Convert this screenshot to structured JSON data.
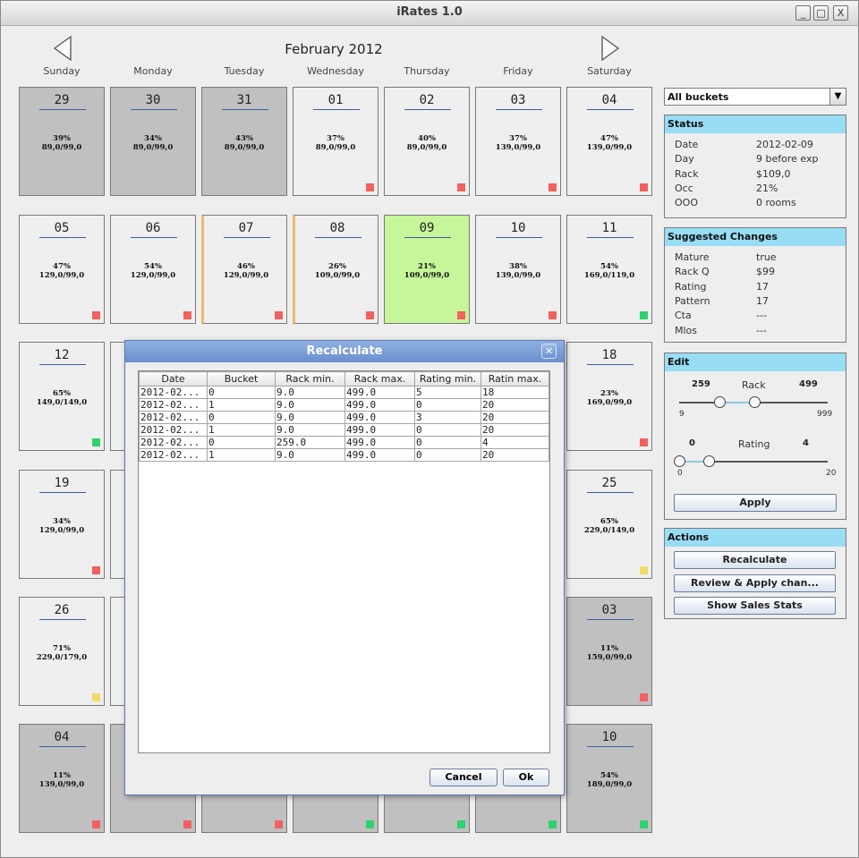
{
  "window": {
    "title": "iRates 1.0",
    "controls": [
      "_",
      "□",
      "X"
    ]
  },
  "calendar": {
    "month_title": "February 2012",
    "day_names": [
      "Sunday",
      "Monday",
      "Tuesday",
      "Wednesday",
      "Thursday",
      "Friday",
      "Saturday"
    ],
    "rows": [
      [
        {
          "day": "29",
          "occ": "39%",
          "rate": "89,0/99,0",
          "style": "gray",
          "flag": ""
        },
        {
          "day": "30",
          "occ": "34%",
          "rate": "89,0/99,0",
          "style": "gray",
          "flag": ""
        },
        {
          "day": "31",
          "occ": "43%",
          "rate": "89,0/99,0",
          "style": "gray",
          "flag": ""
        },
        {
          "day": "01",
          "occ": "37%",
          "rate": "89,0/99,0",
          "style": "",
          "flag": "red"
        },
        {
          "day": "02",
          "occ": "40%",
          "rate": "89,0/99,0",
          "style": "",
          "flag": "red"
        },
        {
          "day": "03",
          "occ": "37%",
          "rate": "139,0/99,0",
          "style": "",
          "flag": "red"
        },
        {
          "day": "04",
          "occ": "47%",
          "rate": "139,0/99,0",
          "style": "",
          "flag": "red"
        }
      ],
      [
        {
          "day": "05",
          "occ": "47%",
          "rate": "129,0/99,0",
          "style": "",
          "flag": "red"
        },
        {
          "day": "06",
          "occ": "54%",
          "rate": "129,0/99,0",
          "style": "",
          "flag": "red"
        },
        {
          "day": "07",
          "occ": "46%",
          "rate": "129,0/99,0",
          "style": "orange",
          "flag": "red"
        },
        {
          "day": "08",
          "occ": "26%",
          "rate": "109,0/99,0",
          "style": "orange",
          "flag": "red"
        },
        {
          "day": "09",
          "occ": "21%",
          "rate": "109,0/99,0",
          "style": "green",
          "flag": "red"
        },
        {
          "day": "10",
          "occ": "38%",
          "rate": "139,0/99,0",
          "style": "",
          "flag": "red"
        },
        {
          "day": "11",
          "occ": "54%",
          "rate": "169,0/119,0",
          "style": "",
          "flag": "green"
        }
      ],
      [
        {
          "day": "12",
          "occ": "65%",
          "rate": "149,0/149,0",
          "style": "",
          "flag": "green"
        },
        {
          "day": "",
          "occ": "",
          "rate": "",
          "style": "",
          "flag": ""
        },
        {
          "day": "",
          "occ": "",
          "rate": "",
          "style": "",
          "flag": ""
        },
        {
          "day": "",
          "occ": "",
          "rate": "",
          "style": "",
          "flag": ""
        },
        {
          "day": "",
          "occ": "",
          "rate": "",
          "style": "",
          "flag": ""
        },
        {
          "day": "",
          "occ": "",
          "rate": "",
          "style": "",
          "flag": ""
        },
        {
          "day": "18",
          "occ": "23%",
          "rate": "169,0/99,0",
          "style": "",
          "flag": "red"
        }
      ],
      [
        {
          "day": "19",
          "occ": "34%",
          "rate": "129,0/99,0",
          "style": "",
          "flag": "red"
        },
        {
          "day": "",
          "occ": "",
          "rate": "",
          "style": "",
          "flag": ""
        },
        {
          "day": "",
          "occ": "",
          "rate": "",
          "style": "",
          "flag": ""
        },
        {
          "day": "",
          "occ": "",
          "rate": "",
          "style": "",
          "flag": ""
        },
        {
          "day": "",
          "occ": "",
          "rate": "",
          "style": "",
          "flag": ""
        },
        {
          "day": "",
          "occ": "",
          "rate": "",
          "style": "",
          "flag": ""
        },
        {
          "day": "25",
          "occ": "65%",
          "rate": "229,0/149,0",
          "style": "",
          "flag": "yellow"
        }
      ],
      [
        {
          "day": "26",
          "occ": "71%",
          "rate": "229,0/179,0",
          "style": "",
          "flag": "yellow"
        },
        {
          "day": "",
          "occ": "",
          "rate": "",
          "style": "",
          "flag": ""
        },
        {
          "day": "",
          "occ": "",
          "rate": "",
          "style": "",
          "flag": ""
        },
        {
          "day": "",
          "occ": "",
          "rate": "",
          "style": "",
          "flag": ""
        },
        {
          "day": "",
          "occ": "",
          "rate": "",
          "style": "",
          "flag": ""
        },
        {
          "day": "",
          "occ": "",
          "rate": "",
          "style": "",
          "flag": ""
        },
        {
          "day": "03",
          "occ": "11%",
          "rate": "159,0/99,0",
          "style": "gray",
          "flag": "red"
        }
      ],
      [
        {
          "day": "04",
          "occ": "11%",
          "rate": "139,0/99,0",
          "style": "gray",
          "flag": "red"
        },
        {
          "day": "",
          "occ": "",
          "rate": "",
          "style": "gray",
          "flag": "red"
        },
        {
          "day": "",
          "occ": "",
          "rate": "",
          "style": "gray",
          "flag": "red"
        },
        {
          "day": "",
          "occ": "",
          "rate": "",
          "style": "gray",
          "flag": "green"
        },
        {
          "day": "",
          "occ": "",
          "rate": "",
          "style": "gray",
          "flag": "green"
        },
        {
          "day": "",
          "occ": "",
          "rate": "",
          "style": "gray",
          "flag": "green"
        },
        {
          "day": "10",
          "occ": "54%",
          "rate": "189,0/99,0",
          "style": "gray",
          "flag": "green"
        }
      ]
    ]
  },
  "bucket_select": {
    "value": "All buckets"
  },
  "status": {
    "title": "Status",
    "rows": [
      {
        "k": "Date",
        "v": "2012-02-09"
      },
      {
        "k": "Day",
        "v": "9 before exp"
      },
      {
        "k": "Rack",
        "v": "$109,0"
      },
      {
        "k": "Occ",
        "v": "21%"
      },
      {
        "k": "OOO",
        "v": "0 rooms"
      }
    ]
  },
  "suggested": {
    "title": "Suggested Changes",
    "rows": [
      {
        "k": "Mature",
        "v": "true"
      },
      {
        "k": "Rack Q",
        "v": "$99"
      },
      {
        "k": "Rating",
        "v": "17"
      },
      {
        "k": "Pattern",
        "v": "17"
      },
      {
        "k": "Cta",
        "v": "---"
      },
      {
        "k": "Mlos",
        "v": "---"
      }
    ]
  },
  "edit": {
    "title": "Edit",
    "rack": {
      "label": "Rack",
      "low": "259",
      "high": "499",
      "min": "9",
      "max": "999"
    },
    "rating": {
      "label": "Rating",
      "low": "0",
      "high": "4",
      "min": "0",
      "max": "20"
    },
    "apply_label": "Apply"
  },
  "actions": {
    "title": "Actions",
    "recalculate": "Recalculate",
    "review": "Review & Apply chan...",
    "stats": "Show Sales Stats"
  },
  "dialog": {
    "title": "Recalculate",
    "columns": [
      "Date",
      "Bucket",
      "Rack min.",
      "Rack max.",
      "Rating min.",
      "Ratin max."
    ],
    "rows": [
      [
        "2012-02...",
        "0",
        "9.0",
        "499.0",
        "5",
        "18"
      ],
      [
        "2012-02...",
        "1",
        "9.0",
        "499.0",
        "0",
        "20"
      ],
      [
        "2012-02...",
        "0",
        "9.0",
        "499.0",
        "3",
        "20"
      ],
      [
        "2012-02...",
        "1",
        "9.0",
        "499.0",
        "0",
        "20"
      ],
      [
        "2012-02...",
        "0",
        "259.0",
        "499.0",
        "0",
        "4"
      ],
      [
        "2012-02...",
        "1",
        "9.0",
        "499.0",
        "0",
        "20"
      ]
    ],
    "cancel": "Cancel",
    "ok": "Ok"
  }
}
